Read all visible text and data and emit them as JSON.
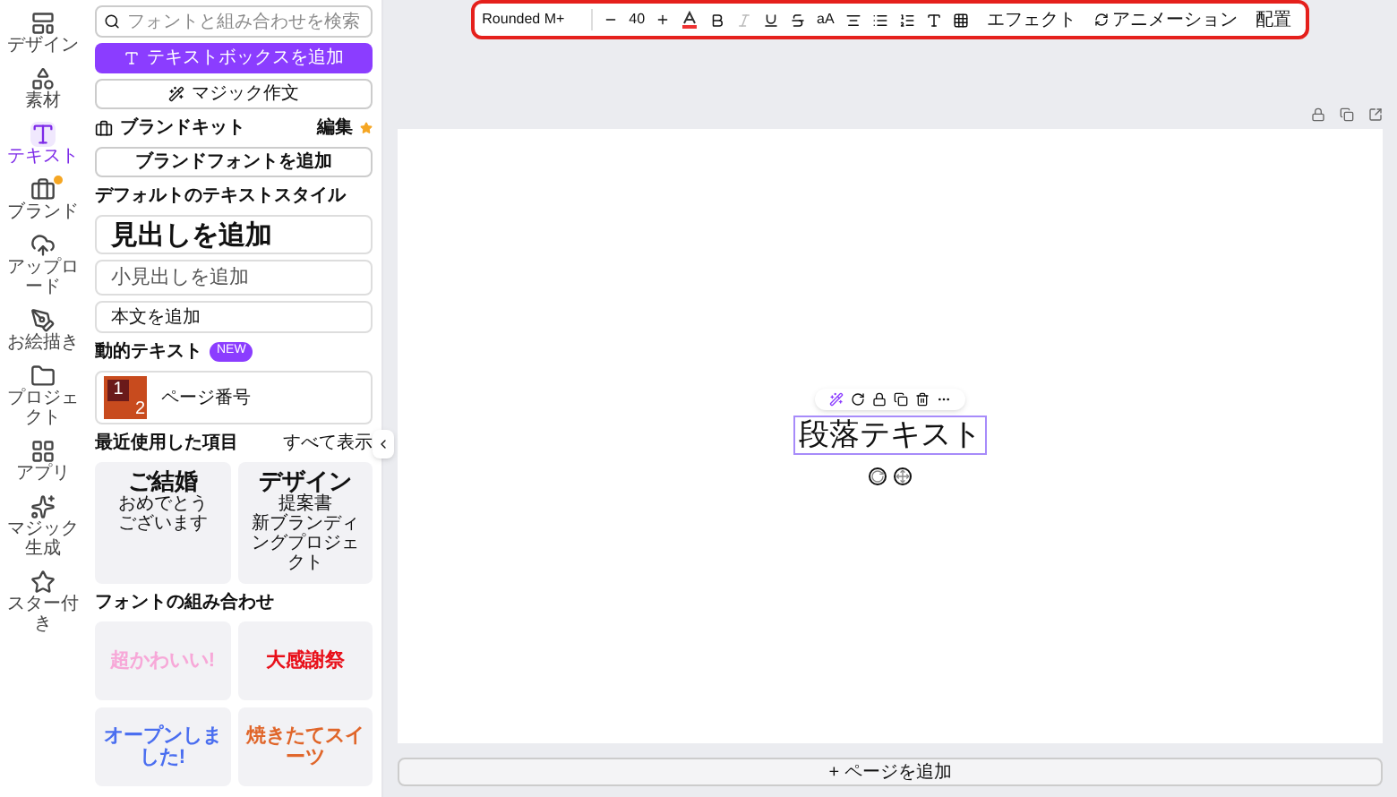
{
  "rail": [
    {
      "label": "デザイン",
      "selected": false,
      "badge": false
    },
    {
      "label": "素材",
      "selected": false,
      "badge": false
    },
    {
      "label": "テキスト",
      "selected": true,
      "badge": false
    },
    {
      "label": "ブランド",
      "selected": false,
      "badge": true
    },
    {
      "label": "アップロード",
      "selected": false,
      "badge": false
    },
    {
      "label": "お絵描き",
      "selected": false,
      "badge": false
    },
    {
      "label": "プロジェクト",
      "selected": false,
      "badge": false
    },
    {
      "label": "アプリ",
      "selected": false,
      "badge": false
    },
    {
      "label": "マジック生成",
      "selected": false,
      "badge": false
    },
    {
      "label": "スター付き",
      "selected": false,
      "badge": false
    }
  ],
  "panel": {
    "search": {
      "placeholder": "フォントと組み合わせを検索"
    },
    "add_textbox": "テキストボックスを追加",
    "magic_write": "マジック作文",
    "brand_kit": {
      "title": "ブランドキット",
      "edit": "編集",
      "add_font": "ブランドフォントを追加"
    },
    "default_styles": {
      "title": "デフォルトのテキストスタイル",
      "heading": "見出しを追加",
      "subheading": "小見出しを追加",
      "body": "本文を追加"
    },
    "dynamic_text": {
      "title": "動的テキスト",
      "badge": "NEW",
      "items": [
        {
          "label": "ページ番号",
          "thumb_digits": [
            "1",
            "2"
          ]
        }
      ]
    },
    "recent": {
      "title": "最近使用した項目",
      "see_all": "すべて表示",
      "items": [
        {
          "lines": [
            "ご結婚",
            "おめでとう",
            "ございます"
          ]
        },
        {
          "lines": [
            "デザイン",
            "提案書",
            "新ブランディングプロジェクト"
          ]
        }
      ]
    },
    "font_combos": {
      "title": "フォントの組み合わせ",
      "items": [
        {
          "text": "超かわいい!",
          "color": "#f7a8d8"
        },
        {
          "text": "大感謝祭",
          "color": "#e8101a"
        },
        {
          "text": "オープンしました!",
          "color": "#4a6ef0"
        },
        {
          "text": "焼きたてスイーツ",
          "color": "#e0662a"
        }
      ]
    }
  },
  "toolbar": {
    "font": "Rounded M+",
    "size": "40",
    "case_label": "aA",
    "effects": "エフェクト",
    "animate": "アニメーション",
    "position": "配置",
    "highlighted": true
  },
  "canvas": {
    "text": "段落テキスト",
    "selected": true,
    "add_page": "+ ページを追加"
  }
}
